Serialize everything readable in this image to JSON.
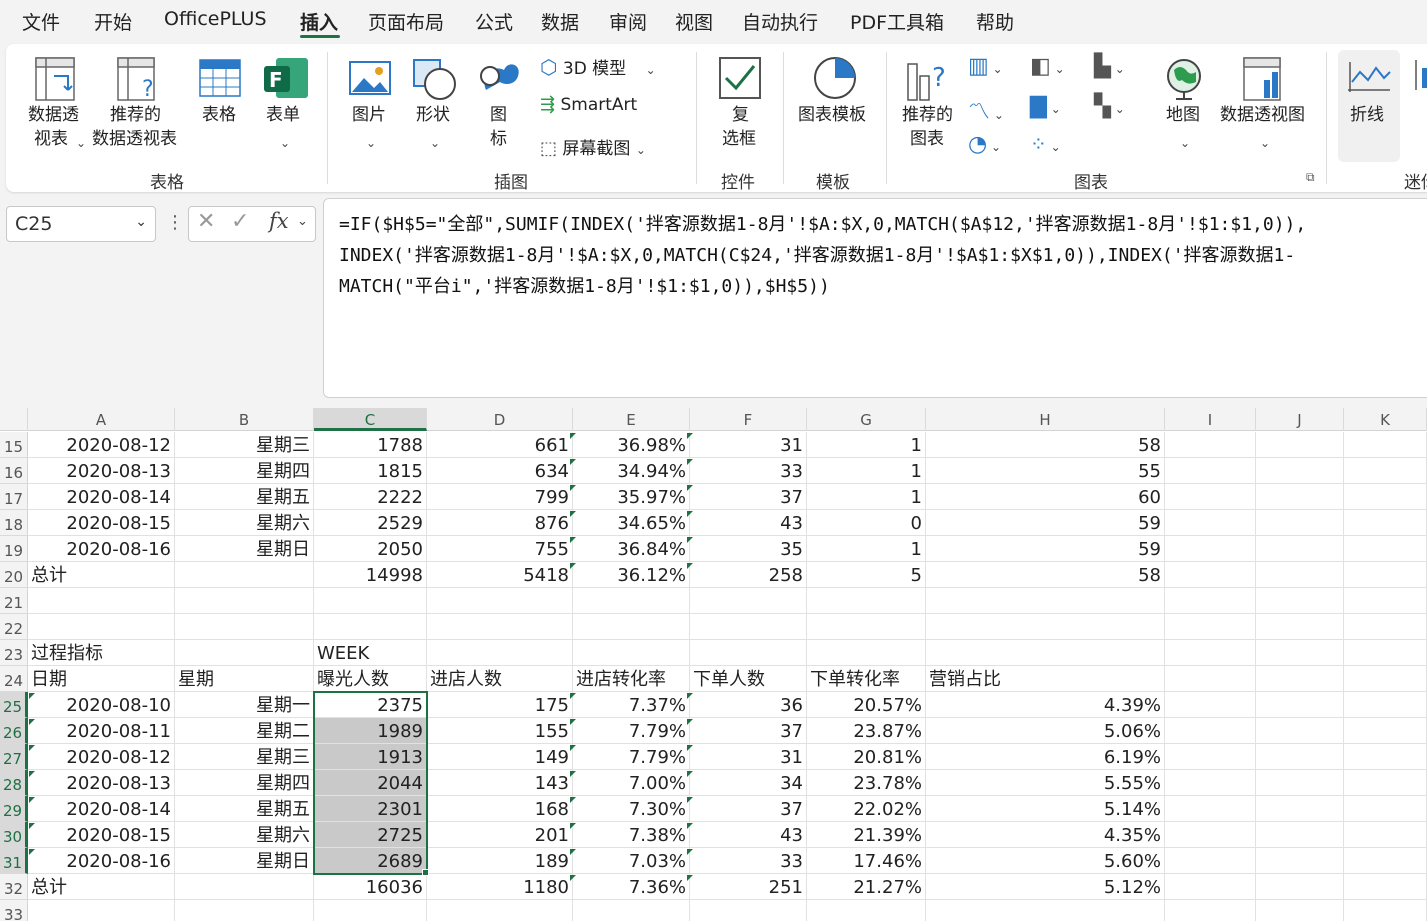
{
  "menu": {
    "tabs": [
      "文件",
      "开始",
      "OfficePLUS",
      "插入",
      "页面布局",
      "公式",
      "数据",
      "审阅",
      "视图",
      "自动执行",
      "PDF工具箱",
      "帮助"
    ],
    "active": "插入"
  },
  "ribbon": {
    "table_group": {
      "label": "表格",
      "pivot_l1": "数据透",
      "pivot_l2": "视表",
      "rec_pivot_l1": "推荐的",
      "rec_pivot_l2": "数据透视表",
      "table": "表格",
      "form": "表单"
    },
    "illus_group": {
      "label": "插图",
      "picture": "图片",
      "shapes": "形状",
      "icons_l1": "图",
      "icons_l2": "标",
      "model3d": "3D 模型",
      "smartart": "SmartArt",
      "screenshot": "屏幕截图"
    },
    "controls_group": {
      "label": "控件",
      "checkbox_l1": "复",
      "checkbox_l2": "选框"
    },
    "template_group": {
      "label": "模板",
      "chart_template": "图表模板"
    },
    "charts_group": {
      "label": "图表",
      "rec_charts_l1": "推荐的",
      "rec_charts_l2": "图表",
      "map": "地图",
      "pivot_chart": "数据透视图"
    },
    "spark_group": {
      "line": "折线",
      "label_partial": "迷你"
    }
  },
  "formula_bar": {
    "name_box": "C25",
    "formula_line1": "=IF($H$5=\"全部\",SUMIF(INDEX('拌客源数据1-8月'!$A:$X,0,MATCH($A$12,'拌客源数据1-8月'!$1:$1,0)),",
    "formula_line2": "INDEX('拌客源数据1-8月'!$A:$X,0,MATCH(C$24,'拌客源数据1-8月'!$A$1:$X$1,0)),INDEX('拌客源数据1-",
    "formula_line3": "MATCH(\"平台i\",'拌客源数据1-8月'!$1:$1,0)),$H$5))"
  },
  "grid": {
    "columns": [
      "A",
      "B",
      "C",
      "D",
      "E",
      "F",
      "G",
      "H",
      "I",
      "J",
      "K"
    ],
    "rows": [
      {
        "n": "15",
        "c": [
          "2020-08-12",
          "星期三",
          "1788",
          "661",
          "36.98%",
          "31",
          "1",
          "58"
        ]
      },
      {
        "n": "16",
        "c": [
          "2020-08-13",
          "星期四",
          "1815",
          "634",
          "34.94%",
          "33",
          "1",
          "55"
        ]
      },
      {
        "n": "17",
        "c": [
          "2020-08-14",
          "星期五",
          "2222",
          "799",
          "35.97%",
          "37",
          "1",
          "60"
        ]
      },
      {
        "n": "18",
        "c": [
          "2020-08-15",
          "星期六",
          "2529",
          "876",
          "34.65%",
          "43",
          "0",
          "59"
        ]
      },
      {
        "n": "19",
        "c": [
          "2020-08-16",
          "星期日",
          "2050",
          "755",
          "36.84%",
          "35",
          "1",
          "59"
        ]
      },
      {
        "n": "20",
        "c": [
          "总计",
          "",
          "14998",
          "5418",
          "36.12%",
          "258",
          "5",
          "58"
        ]
      },
      {
        "n": "21",
        "c": [
          "",
          "",
          "",
          "",
          "",
          "",
          "",
          ""
        ]
      },
      {
        "n": "22",
        "c": [
          "",
          "",
          "",
          "",
          "",
          "",
          "",
          ""
        ]
      },
      {
        "n": "23",
        "c": [
          "过程指标",
          "",
          "WEEK",
          "",
          "",
          "",
          "",
          ""
        ]
      },
      {
        "n": "24",
        "c": [
          "日期",
          "星期",
          "曝光人数",
          "进店人数",
          "进店转化率",
          "下单人数",
          "下单转化率",
          "营销占比"
        ]
      },
      {
        "n": "25",
        "c": [
          "2020-08-10",
          "星期一",
          "2375",
          "175",
          "7.37%",
          "36",
          "20.57%",
          "4.39%"
        ]
      },
      {
        "n": "26",
        "c": [
          "2020-08-11",
          "星期二",
          "1989",
          "155",
          "7.79%",
          "37",
          "23.87%",
          "5.06%"
        ]
      },
      {
        "n": "27",
        "c": [
          "2020-08-12",
          "星期三",
          "1913",
          "149",
          "7.79%",
          "31",
          "20.81%",
          "6.19%"
        ]
      },
      {
        "n": "28",
        "c": [
          "2020-08-13",
          "星期四",
          "2044",
          "143",
          "7.00%",
          "34",
          "23.78%",
          "5.55%"
        ]
      },
      {
        "n": "29",
        "c": [
          "2020-08-14",
          "星期五",
          "2301",
          "168",
          "7.30%",
          "37",
          "22.02%",
          "5.14%"
        ]
      },
      {
        "n": "30",
        "c": [
          "2020-08-15",
          "星期六",
          "2725",
          "201",
          "7.38%",
          "43",
          "21.39%",
          "4.35%"
        ]
      },
      {
        "n": "31",
        "c": [
          "2020-08-16",
          "星期日",
          "2689",
          "189",
          "7.03%",
          "33",
          "17.46%",
          "5.60%"
        ]
      },
      {
        "n": "32",
        "c": [
          "总计",
          "",
          "16036",
          "1180",
          "7.36%",
          "251",
          "21.27%",
          "5.12%"
        ]
      },
      {
        "n": "33",
        "c": [
          "",
          "",
          "",
          "",
          "",
          "",
          "",
          ""
        ]
      }
    ]
  },
  "colors": {
    "accent_green": "#1e7145",
    "selection_fill": "#c9c9c9",
    "chrome_bg": "#f3f3f3"
  }
}
